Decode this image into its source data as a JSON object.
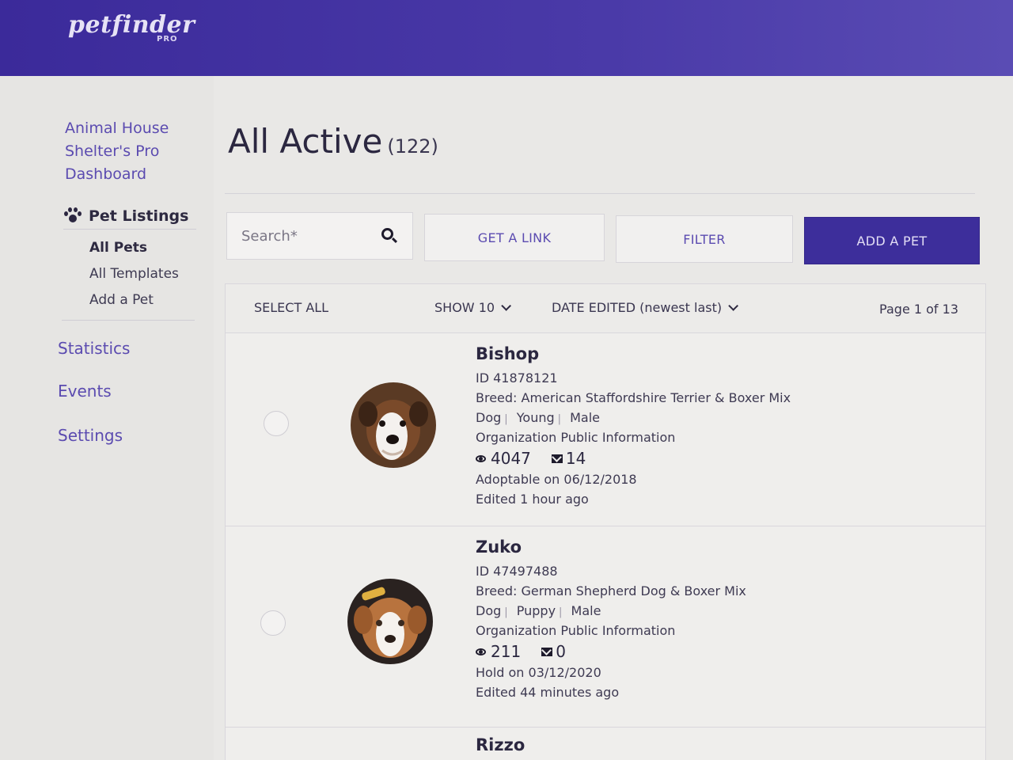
{
  "brand": {
    "logo": "petfinder",
    "sub": "PRO"
  },
  "sidebar": {
    "org_link": "Animal House Shelter's Pro Dashboard",
    "section": "Pet Listings",
    "subitems": [
      "All Pets",
      "All Templates",
      "Add a Pet"
    ],
    "links": [
      "Statistics",
      "Events",
      "Settings"
    ]
  },
  "main": {
    "title": "All Active",
    "count": "(122)",
    "search_placeholder": "Search*",
    "buttons": {
      "get_link": "GET A LINK",
      "filter": "FILTER",
      "add_pet": "ADD A PET"
    },
    "toolbar": {
      "select_all": "SELECT ALL",
      "show": "SHOW 10",
      "sort": "DATE EDITED (newest last)",
      "page": "Page 1 of 13"
    }
  },
  "pets": [
    {
      "name": "Bishop",
      "id": "ID 41878121",
      "breed": "Breed: American Staffordshire Terrier & Boxer Mix",
      "species": "Dog",
      "age": "Young",
      "sex": "Male",
      "org_info": "Organization Public Information",
      "views": "4047",
      "messages": "14",
      "status": "Adoptable on 06/12/2018",
      "edited": "Edited 1 hour ago"
    },
    {
      "name": "Zuko",
      "id": "ID 47497488",
      "breed": "Breed: German Shepherd Dog & Boxer Mix",
      "species": "Dog",
      "age": "Puppy",
      "sex": "Male",
      "org_info": "Organization Public Information",
      "views": "211",
      "messages": "0",
      "status": "Hold on 03/12/2020",
      "edited": "Edited 44 minutes ago"
    },
    {
      "name": "Rizzo"
    }
  ],
  "icons": {
    "search": "search-icon",
    "paw": "paw-icon",
    "eye": "eye-icon",
    "mail": "mail-icon",
    "chevron": "chevron-down-icon"
  },
  "colors": {
    "header": "#3b2a9a",
    "accent": "#5b4bb0",
    "primary_button": "#3d2e9b",
    "background": "#e9e8e6"
  }
}
